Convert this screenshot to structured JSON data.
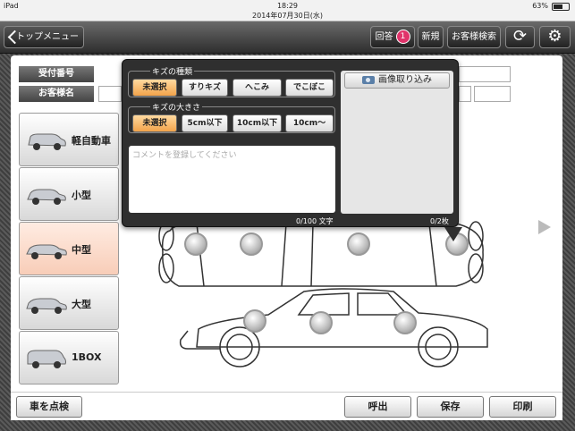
{
  "status_bar": {
    "device": "iPad",
    "time": "18:29",
    "date": "2014年07月30日(水)",
    "battery": "63%",
    "battery_level": 0.63
  },
  "nav": {
    "back_label": "トップメニュー",
    "answer_label": "回答",
    "answer_badge": "1",
    "new_label": "新規",
    "search_label": "お客様検索",
    "refresh_icon": "refresh-icon",
    "settings_icon": "gear-icon"
  },
  "form": {
    "reception_label": "受付番号",
    "customer_label": "お客様名"
  },
  "vehicle_sizes": [
    {
      "label": "軽自動車",
      "selected": false
    },
    {
      "label": "小型",
      "selected": false
    },
    {
      "label": "中型",
      "selected": true
    },
    {
      "label": "大型",
      "selected": false
    },
    {
      "label": "1BOX",
      "selected": false
    }
  ],
  "popover": {
    "damage_type_title": "キズの種類",
    "damage_types": [
      "未選択",
      "すりキズ",
      "へこみ",
      "でこぼこ"
    ],
    "damage_type_selected": "未選択",
    "damage_size_title": "キズの大きさ",
    "damage_sizes": [
      "未選択",
      "5cm以下",
      "10cm以下",
      "10cm〜"
    ],
    "damage_size_selected": "未選択",
    "comment_placeholder": "コメントを登録してください",
    "char_counter": "0/100 文字",
    "image_button": "画像取り込み",
    "image_counter": "0/2枚"
  },
  "bottom": {
    "inspect_label": "車を点検",
    "call_label": "呼出",
    "save_label": "保存",
    "print_label": "印刷"
  },
  "colors": {
    "selected_vehicle": "#f8cdb8",
    "selected_option": "#f2a34b",
    "badge": "#e0336a"
  }
}
